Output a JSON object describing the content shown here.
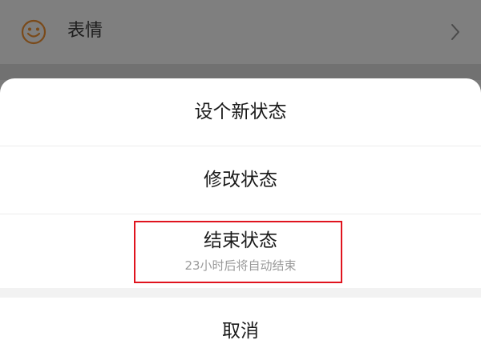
{
  "background_row": {
    "icon": "smiley-face-icon",
    "label": "表情",
    "chevron": "chevron-right-icon"
  },
  "action_sheet": {
    "options": [
      {
        "label": "设个新状态"
      },
      {
        "label": "修改状态"
      },
      {
        "label": "结束状态",
        "sublabel": "23小时后将自动结束"
      }
    ],
    "cancel_label": "取消"
  },
  "colors": {
    "overlay": "#7b7b7b",
    "sheet_background": "#ffffff",
    "highlight_border": "#e0141e",
    "icon_orange": "#c8762a",
    "sublabel_gray": "#9a9a9a"
  }
}
